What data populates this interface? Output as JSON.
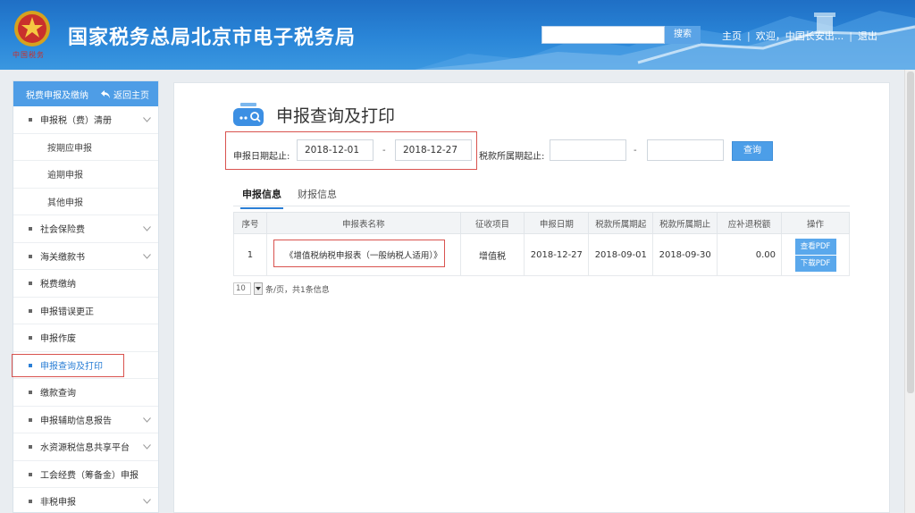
{
  "header": {
    "site_title": "国家税务总局北京市电子税务局",
    "emblem_caption": "中国税务",
    "search_placeholder": "",
    "search_button": "搜索",
    "nav": {
      "home": "主页",
      "welcome": "欢迎，中国长安出...",
      "logout": "退出"
    }
  },
  "sidebar": {
    "top_left": "税费申报及缴纳",
    "top_right": "返回主页",
    "items": [
      {
        "label": "申报税（费）清册",
        "expandable": true
      },
      {
        "label": "按期应申报",
        "sub": true
      },
      {
        "label": "逾期申报",
        "sub": true
      },
      {
        "label": "其他申报",
        "sub": true
      },
      {
        "label": "社会保险费",
        "expandable": true
      },
      {
        "label": "海关缴款书",
        "expandable": true
      },
      {
        "label": "税费缴纳",
        "expandable": false
      },
      {
        "label": "申报错误更正",
        "expandable": false
      },
      {
        "label": "申报作废",
        "expandable": false
      },
      {
        "label": "申报查询及打印",
        "expandable": false,
        "active": true
      },
      {
        "label": "缴款查询",
        "expandable": false
      },
      {
        "label": "申报辅助信息报告",
        "expandable": true
      },
      {
        "label": "水资源税信息共享平台",
        "expandable": true
      },
      {
        "label": "工会经费（筹备金）申报",
        "expandable": false
      },
      {
        "label": "非税申报",
        "expandable": true
      }
    ]
  },
  "page": {
    "title": "申报查询及打印",
    "query": {
      "date_label": "申报日期起止:",
      "date_from": "2018-12-01",
      "date_to": "2018-12-27",
      "period_label": "税款所属期起止:",
      "period_from": "",
      "period_to": "",
      "dash": "-",
      "button": "查询"
    },
    "tabs": [
      "申报信息",
      "财报信息"
    ],
    "table": {
      "headers": [
        "序号",
        "申报表名称",
        "征收项目",
        "申报日期",
        "税款所属期起",
        "税款所属期止",
        "应补退税额",
        "操作"
      ],
      "rows": [
        {
          "index": "1",
          "name": "《增值税纳税申报表（一般纳税人适用）》",
          "item": "增值税",
          "date": "2018-12-27",
          "period_start": "2018-09-01",
          "period_end": "2018-09-30",
          "amount": "0.00",
          "btn_view": "查看PDF",
          "btn_download": "下载PDF"
        }
      ]
    },
    "pager": {
      "page_size": "10",
      "text": "条/页，共1条信息"
    }
  },
  "colors": {
    "header_blue": "#2a86d8",
    "button_blue": "#4c9ee8",
    "highlight_red": "#d9534f",
    "active_text": "#2b7fd6"
  }
}
